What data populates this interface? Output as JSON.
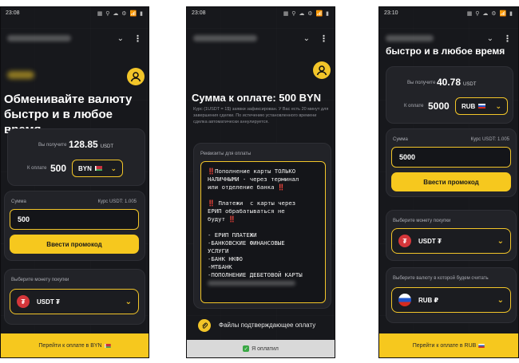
{
  "screen1": {
    "status_time": "23:08",
    "status_icons": "▦ ⚲ ☁ ⚙ 📶 ▮",
    "heading": "Обменивайте валюту быстро и в любое время",
    "receive_label": "Вы получите",
    "receive_value": "128.85",
    "receive_unit": "USDT",
    "pay_label": "К оплате",
    "pay_value": "500",
    "currency": "BYN",
    "amount_label": "Сумма",
    "rate_label": "Курс USDT: 1.005",
    "amount_value": "500",
    "promo_button": "Ввести промокод",
    "choose_coin_label": "Выберите монету покупки",
    "coin": "USDT ₮",
    "go_button": "Перейти к оплате в BYN"
  },
  "screen2": {
    "status_time": "23:08",
    "status_icons": "▦ ⚲ ☁ ⚙ 📶 ▮",
    "heading": "Сумма к оплате: 500 BYN",
    "note": "Курс (1USDT = 1$) заявки зафиксирован. У Вас есть 20 минут для завершения сделки. По истечению установленного времени сделка автоматически аннулируется.",
    "requisites_label": "Реквизиты для оплаты",
    "requisites_lines": [
      "‼️Пополнение карты ТОЛЬКО",
      "НАЛИЧНЫМИ - через терминал",
      "или отделение банка ‼️",
      "",
      "‼️ Платежи  с карты через",
      "ЕРИП обрабатываться не",
      "будут ‼️",
      "",
      "- ЕРИП ПЛАТЕЖИ",
      "-БАНКОВСКИЕ ФИНАНСОВЫЕ",
      "УСЛУГИ",
      "-БАНК НКФО",
      "-МТБАНК",
      "-ПОПОЛНЕНИЕ ДЕБЕТОВОЙ КАРТЫ"
    ],
    "files_label": "Файлы подтверждающее оплату",
    "paid_button": "Я оплатил"
  },
  "screen3": {
    "status_time": "23:10",
    "status_icons": "▦ ⚲ ☁ ⚙ 📶 ▮",
    "heading": "быстро и в любое время",
    "receive_label": "Вы получите",
    "receive_value": "40.78",
    "receive_unit": "USDT",
    "pay_label": "К оплате",
    "pay_value": "5000",
    "currency": "RUB",
    "amount_label": "Сумма",
    "rate_label": "Курс USDT: 1.005",
    "amount_value": "5000",
    "promo_button": "Ввести промокод",
    "choose_coin_label": "Выберите монету покупки",
    "coin": "USDT ₮",
    "choose_currency_label": "Выберите валюту в которой будем считать",
    "currency2": "RUB ₽",
    "go_button": "Перейти к оплате в RUB"
  },
  "colors": {
    "accent": "#f6c81e",
    "background": "#17181c",
    "card": "#222328"
  }
}
